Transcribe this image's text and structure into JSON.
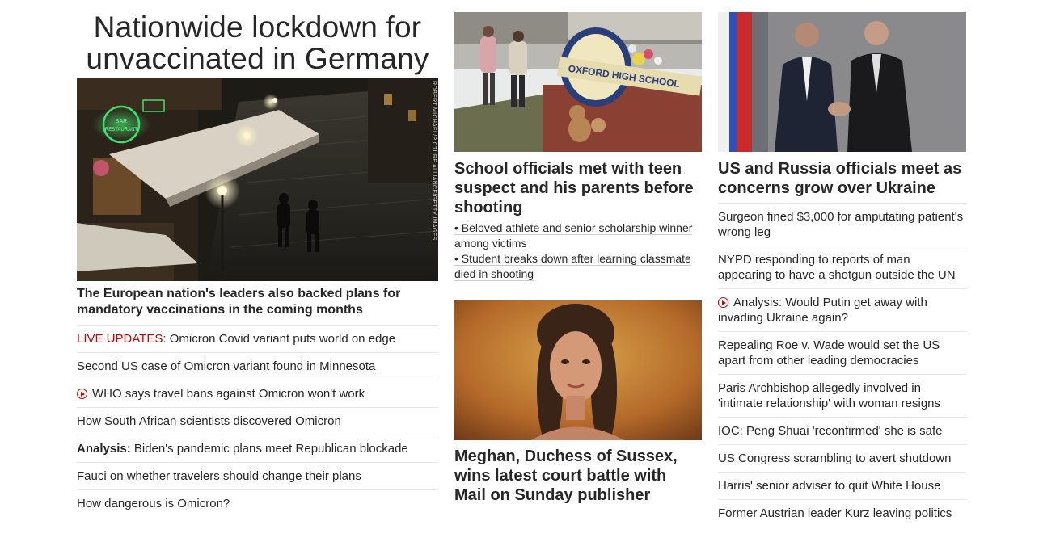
{
  "left": {
    "headline": "Nationwide lockdown for unvaccinated in Germany",
    "image_credit": "ROBERT MICHAEL/PICTURE ALLIANCE/GETTY IMAGES",
    "image_sign_1": "BAR",
    "image_sign_2": "RESTAURANT",
    "sub_headline": "The European nation's leaders also backed plans for mandatory vaccinations in the coming months",
    "links": [
      {
        "prefix": "LIVE UPDATES:",
        "text": " Omicron Covid variant puts world on edge"
      },
      {
        "text": "Second US case of Omicron variant found in Minnesota"
      },
      {
        "text": "WHO says travel bans against Omicron won't work"
      },
      {
        "text": "How South African scientists discovered Omicron"
      },
      {
        "prefix": "Analysis:",
        "text": " Biden's pandemic plans meet Republican blockade"
      },
      {
        "text": "Fauci on whether travelers should change their plans"
      },
      {
        "text": "How dangerous is Omicron?"
      }
    ]
  },
  "middle": {
    "story1": {
      "sign_text": "OXFORD HIGH SCHOOL",
      "title": "School officials met with teen suspect and his parents before shooting",
      "bullets": [
        "• Beloved athlete and senior scholarship winner among victims",
        "• Student breaks down after learning classmate died in shooting"
      ]
    },
    "story2": {
      "title": "Meghan, Duchess of Sussex, wins latest court battle with Mail on Sunday publisher"
    }
  },
  "right": {
    "title": "US and Russia officials meet as concerns grow over Ukraine",
    "links": [
      "Surgeon fined $3,000 for amputating patient's wrong leg",
      "NYPD responding to reports of man appearing to have a shotgun outside the UN",
      "Analysis: Would Putin get away with invading Ukraine again?",
      "Repealing Roe v. Wade would set the US apart from other leading democracies",
      "Paris Archbishop allegedly involved in 'intimate relationship' with woman resigns",
      "IOC: Peng Shuai 'reconfirmed' she is safe",
      "US Congress scrambling to avert shutdown",
      "Harris' senior adviser to quit White House",
      "Former Austrian leader Kurz leaving politics"
    ]
  },
  "colors": {
    "text": "#262626",
    "live_red": "#cc0000",
    "divider": "#e6e6e6"
  }
}
